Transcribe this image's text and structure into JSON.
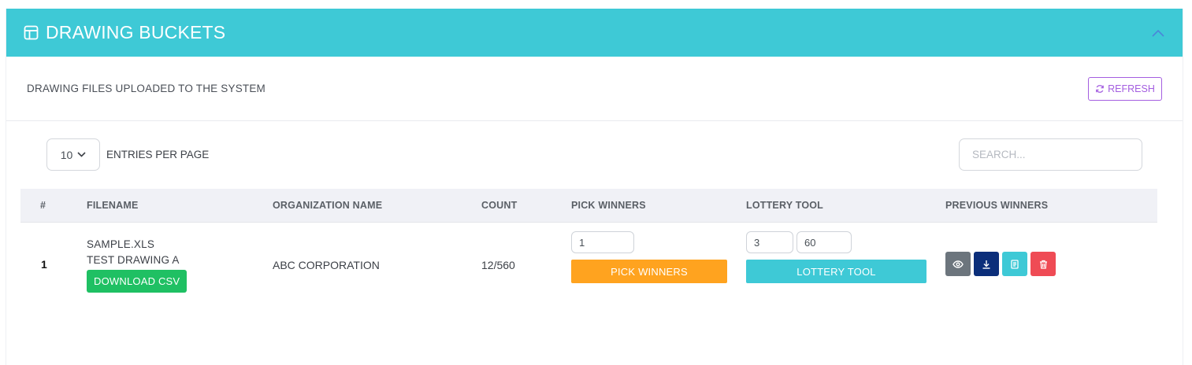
{
  "header": {
    "title": "DRAWING BUCKETS",
    "icon": "table-icon",
    "collapse_icon": "chevron-up-icon"
  },
  "subheader": {
    "text": "DRAWING FILES UPLOADED TO THE SYSTEM",
    "refresh_label": "REFRESH"
  },
  "controls": {
    "page_size": "10",
    "entries_label": "ENTRIES PER PAGE",
    "search_placeholder": "SEARCH..."
  },
  "table": {
    "columns": [
      "#",
      "FILENAME",
      "ORGANIZATION NAME",
      "COUNT",
      "PICK WINNERS",
      "LOTTERY TOOL",
      "PREVIOUS WINNERS"
    ],
    "rows": [
      {
        "index": "1",
        "filename": "SAMPLE.XLS",
        "drawing_name": "TEST DRAWING A",
        "download_label": "DOWNLOAD CSV",
        "organization": "ABC CORPORATION",
        "count": "12/560",
        "pick_winners_value": "1",
        "pick_winners_label": "PICK WINNERS",
        "lottery_value_1": "3",
        "lottery_value_2": "60",
        "lottery_label": "LOTTERY TOOL"
      }
    ]
  },
  "colors": {
    "header": "#3ec9d6",
    "refresh": "#a45ee0",
    "download": "#1fc063",
    "pick": "#ffa31f",
    "lottery": "#3ec9d6",
    "view": "#6c757d",
    "download_icon_btn": "#0b2e7a",
    "notes": "#3ec9d6",
    "delete": "#ef4b55"
  }
}
